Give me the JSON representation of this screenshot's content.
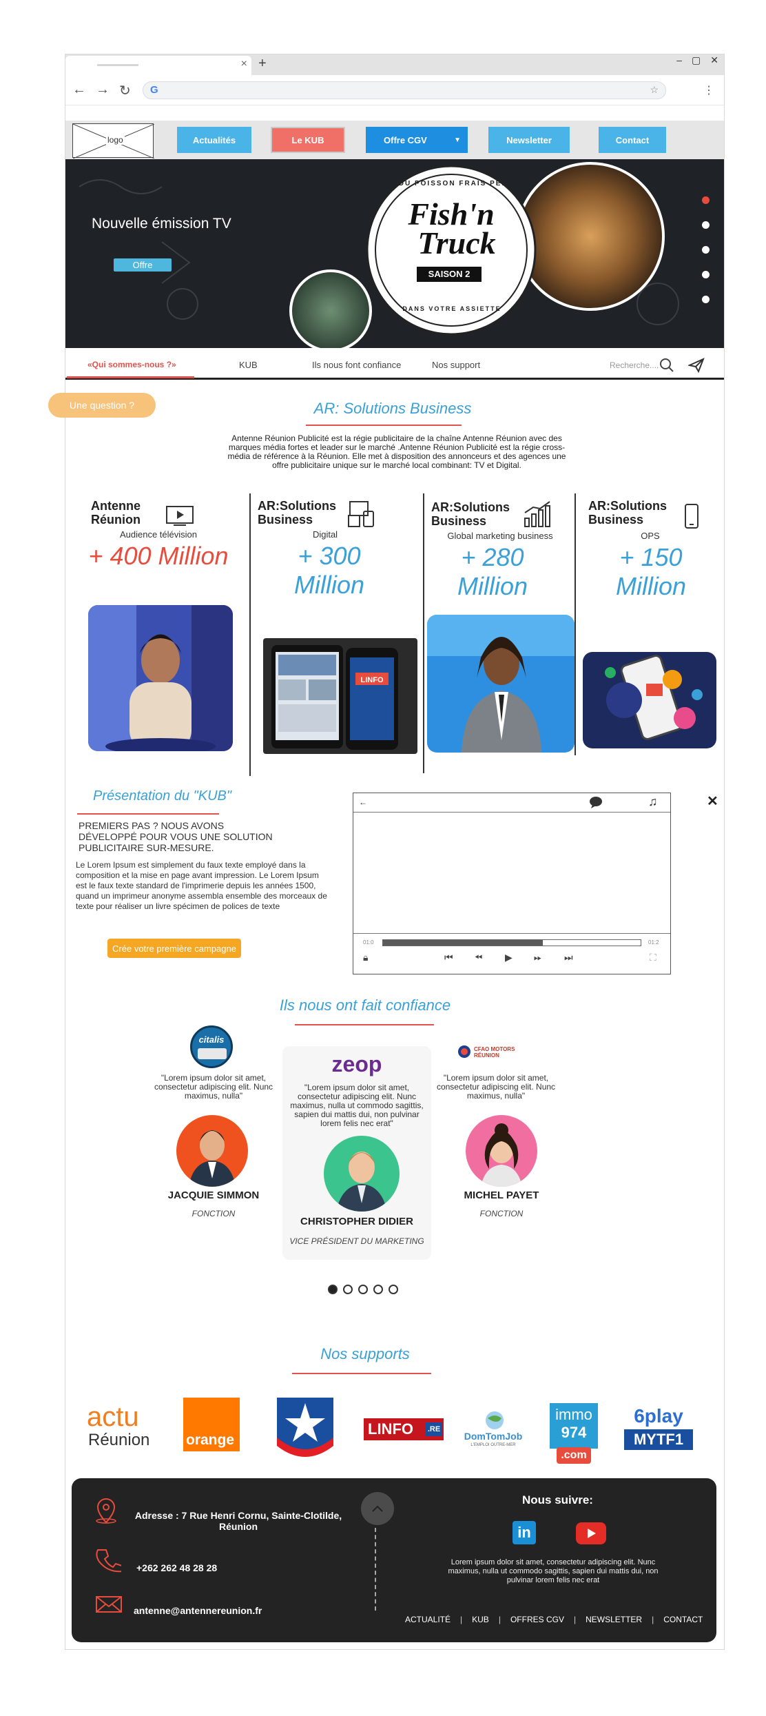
{
  "browser": {
    "tab_close": "×",
    "new_tab": "+",
    "controls": [
      "–",
      "▢",
      "✕"
    ],
    "google_letter": "G"
  },
  "header": {
    "logo_text": "logo",
    "nav": [
      {
        "label": "Actualités",
        "color": "#4ab3e8"
      },
      {
        "label": "Le KUB",
        "color": "#f07068"
      },
      {
        "label": "Offre CGV",
        "color": "#1e8fe0"
      },
      {
        "label": "Newsletter",
        "color": "#4ab3e8"
      },
      {
        "label": "Contact",
        "color": "#4ab3e8"
      }
    ]
  },
  "hero": {
    "title": "Nouvelle émission TV",
    "button": "Offre",
    "badge_top": "DU POISSON FRAIS PÉI",
    "badge_main1": "Fish'n",
    "badge_main2": "Truck",
    "badge_season": "SAISON 2",
    "badge_bottom": "DANS VOTRE ASSIETTE"
  },
  "subnav": {
    "items": [
      "«Qui sommes-nous ?»",
      "KUB",
      "Ils nous font confiance",
      "Nos support"
    ],
    "search_placeholder": "Recherche...."
  },
  "question_button": "Une question ?",
  "intro": {
    "title": "AR: Solutions Business",
    "text": "Antenne Réunion Publicité est la régie publicitaire de la chaîne Antenne Réunion avec des marques média fortes et leader sur le marché .Antenne Réunion Publicité est la régie cross-média de référence à la Réunion. Elle met à disposition des annonceurs et des agences une offre publicitaire unique sur le marché local combinant: TV et Digital."
  },
  "stats": [
    {
      "name1": "Antenne",
      "name2": "Réunion",
      "sub": "Audience télévision",
      "value": "+ 400 Million",
      "color": "#e84c3d"
    },
    {
      "name1": "AR:Solutions",
      "name2": "Business",
      "sub": "Digital",
      "value": "+ 300 Million",
      "color": "#3aa0d8"
    },
    {
      "name1": "AR:Solutions",
      "name2": "Business",
      "sub": "Global marketing business",
      "value": "+ 280 Million",
      "color": "#3aa0d8"
    },
    {
      "name1": "AR:Solutions",
      "name2": "Business",
      "sub": "OPS",
      "value": "+ 150 Million",
      "color": "#3aa0d8"
    }
  ],
  "kub": {
    "title": "Présentation du \"KUB\"",
    "subtitle": "PREMIERS PAS ? NOUS AVONS DÉVELOPPÉ POUR VOUS UNE SOLUTION PUBLICITAIRE SUR-MESURE.",
    "text": "Le Lorem Ipsum est simplement du faux texte employé dans la composition et la mise en page avant impression. Le Lorem Ipsum est le faux texte standard de l'imprimerie depuis les années 1500, quand un imprimeur anonyme assembla ensemble des morceaux de texte pour réaliser un livre spécimen de polices de texte",
    "button": "Crée votre première campagne",
    "player": {
      "time_start": "01:0",
      "time_end": "01:2",
      "progress": 0.62
    }
  },
  "trust": {
    "title": "Ils nous ont fait confiance",
    "items": [
      {
        "logo": "citalis",
        "quote": "\"Lorem ipsum dolor sit amet, consectetur adipiscing elit. Nunc maximus, nulla\"",
        "name": "JACQUIE SIMMON",
        "role": "FONCTION"
      },
      {
        "logo": "zeop",
        "quote": "\"Lorem ipsum dolor sit amet, consectetur adipiscing elit. Nunc maximus, nulla ut commodo sagittis, sapien dui mattis dui, non pulvinar lorem felis nec erat\"",
        "name": "CHRISTOPHER DIDIER",
        "role": "VICE PRÉSIDENT DU MARKETING"
      },
      {
        "logo": "CFAO MOTORS RÉUNION",
        "quote": "\"Lorem ipsum dolor sit amet, consectetur adipiscing elit. Nunc maximus, nulla\"",
        "name": "MICHEL PAYET",
        "role": "FONCTION"
      }
    ],
    "pages": 5,
    "active_page": 1
  },
  "supports": {
    "title": "Nos supports",
    "logos": {
      "actu1": "actu",
      "actu2": "Réunion",
      "orange": "orange",
      "linfo": "LINFO",
      "linfo_re": ".RE",
      "domtom": "DomTomJob",
      "domtom_sub": "L'EMPLOI OUTRE-MER",
      "immo1": "immo",
      "immo2": "974",
      "immo3": ".com",
      "play1": "6play",
      "play2": "MYTF1"
    }
  },
  "footer": {
    "address": "Adresse : 7 Rue Henri Cornu, Sainte-Clotilde, Réunion",
    "phone": "+262 262 48 28 28",
    "email": "antenne@antennereunion.fr",
    "follow": "Nous suivre:",
    "paragraph": "Lorem ipsum dolor sit amet, consectetur adipiscing elit. Nunc maximus, nulla ut commodo sagittis, sapien dui mattis dui, non pulvinar lorem felis nec erat",
    "links": [
      "ACTUALITÉ",
      "KUB",
      "OFFRES CGV",
      "NEWSLETTER",
      "CONTACT"
    ],
    "linkedin": "in"
  }
}
